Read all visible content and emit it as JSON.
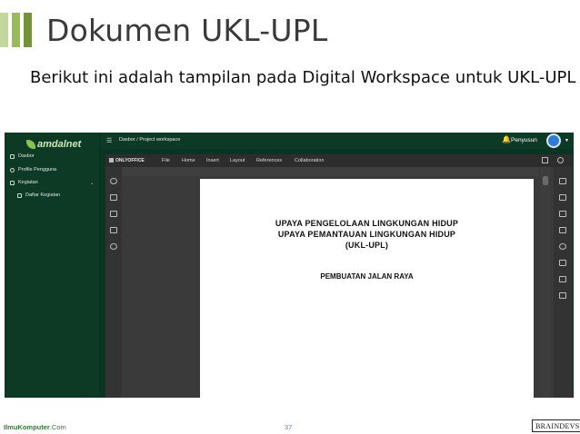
{
  "slide": {
    "title": "Dokumen UKL-UPL",
    "subtitle": "Berikut ini adalah tampilan pada Digital Workspace untuk UKL-UPL",
    "page_number": "37",
    "footer_left_name": "IlmuKomputer",
    "footer_left_suffix": ".Com",
    "footer_right_logo": "BRAINDEVS"
  },
  "app": {
    "brand": "amdalnet",
    "sidebar": {
      "items": [
        {
          "label": "Dasbor",
          "icon": "dashboard-icon"
        },
        {
          "label": "Profile Pengguna",
          "icon": "user-icon"
        },
        {
          "label": "Kegiatan",
          "icon": "checkbox-icon"
        },
        {
          "label": "Daftar Kegiatan",
          "icon": "list-icon"
        }
      ]
    },
    "topbar": {
      "menu_icon": "menu-icon",
      "breadcrumb": "Dasbor  /  Project workspace",
      "user_label": "Penyusun",
      "bell_icon": "bell-icon"
    }
  },
  "editor": {
    "logo": "ONLYOFFICE",
    "menu": [
      "File",
      "Home",
      "Insert",
      "Layout",
      "References",
      "Collaboration"
    ],
    "document": {
      "heading_lines": [
        "UPAYA PENGELOLAAN LINGKUNGAN HIDUP",
        "UPAYA PEMANTAUAN LINGKUNGAN HIDUP",
        "(UKL-UPL)"
      ],
      "subheading": "PEMBUATAN JALAN RAYA"
    }
  },
  "colors": {
    "sidebar_bg": "#0c3a25",
    "accent_light": "#c3d69b",
    "accent_mid": "#9bbb59",
    "accent_dark": "#76923c"
  }
}
